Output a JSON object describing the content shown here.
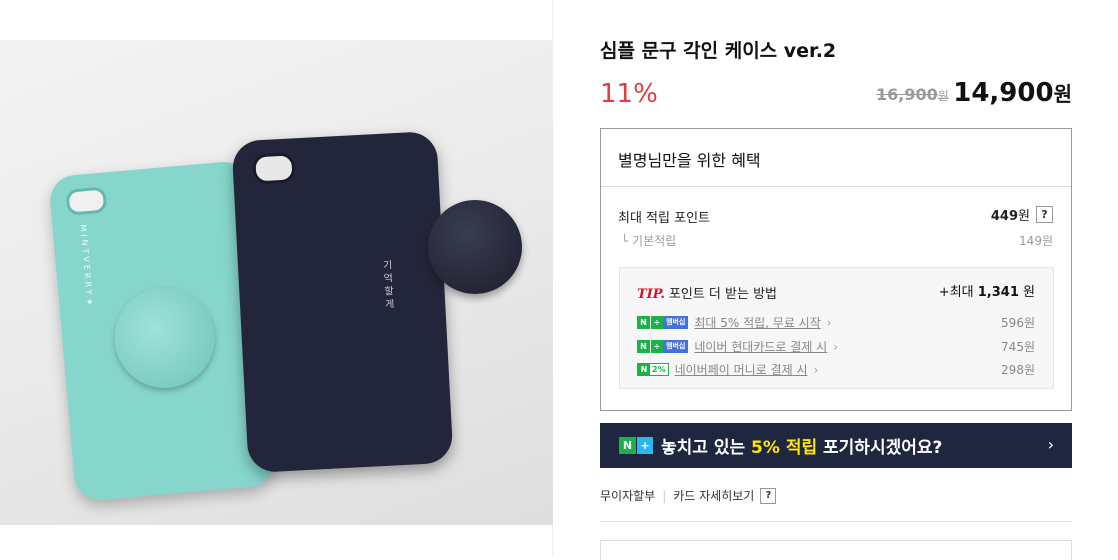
{
  "product": {
    "title": "심플 문구 각인 케이스 ver.2",
    "discount": "11%",
    "original_price": "16,900",
    "original_unit": "원",
    "price": "14,900",
    "price_unit": "원"
  },
  "photo": {
    "mint_case_text": "MINTVERRY★",
    "navy_case_text": "기억할게"
  },
  "benefit": {
    "header": "별명님만을 위한 혜택",
    "max_label": "최대 적립 포인트",
    "max_value": "449",
    "max_unit": "원",
    "help": "?",
    "basic_label": "└ 기본적립",
    "basic_value": "149원",
    "tip": {
      "tip_word": "TIP.",
      "heading": "포인트 더 받는 방법",
      "total_prefix": "+최대",
      "total_value": "1,341",
      "total_unit": "원",
      "items": [
        {
          "badge_n": "N",
          "badge_plus": "+",
          "badge_member": "멤버십",
          "label": "최대 5% 적립, 무료 시작",
          "value": "596원"
        },
        {
          "badge_n": "N",
          "badge_plus": "+",
          "badge_member": "멤버십",
          "label": "네이버 현대카드로 결제 시",
          "value": "745원"
        },
        {
          "badge_n": "N",
          "badge_pct": "2%",
          "label": "네이버페이 머니로 결제 시",
          "value": "298원"
        }
      ],
      "chevron": "›"
    }
  },
  "banner": {
    "badge_n": "N",
    "badge_plus": "+",
    "text_pre": "놓치고 있는 ",
    "text_highlight": "5% 적립",
    "text_post": " 포기하시겠어요?",
    "arrow": "›"
  },
  "links": {
    "installment": "무이자할부",
    "card_detail": "카드 자세히보기",
    "help": "?"
  },
  "colors": {
    "discount_red": "#e23b3b",
    "banner_bg": "#1f2740",
    "highlight_yellow": "#ffe600",
    "naver_green": "#19b34a",
    "membership_blue": "#4472d9"
  }
}
